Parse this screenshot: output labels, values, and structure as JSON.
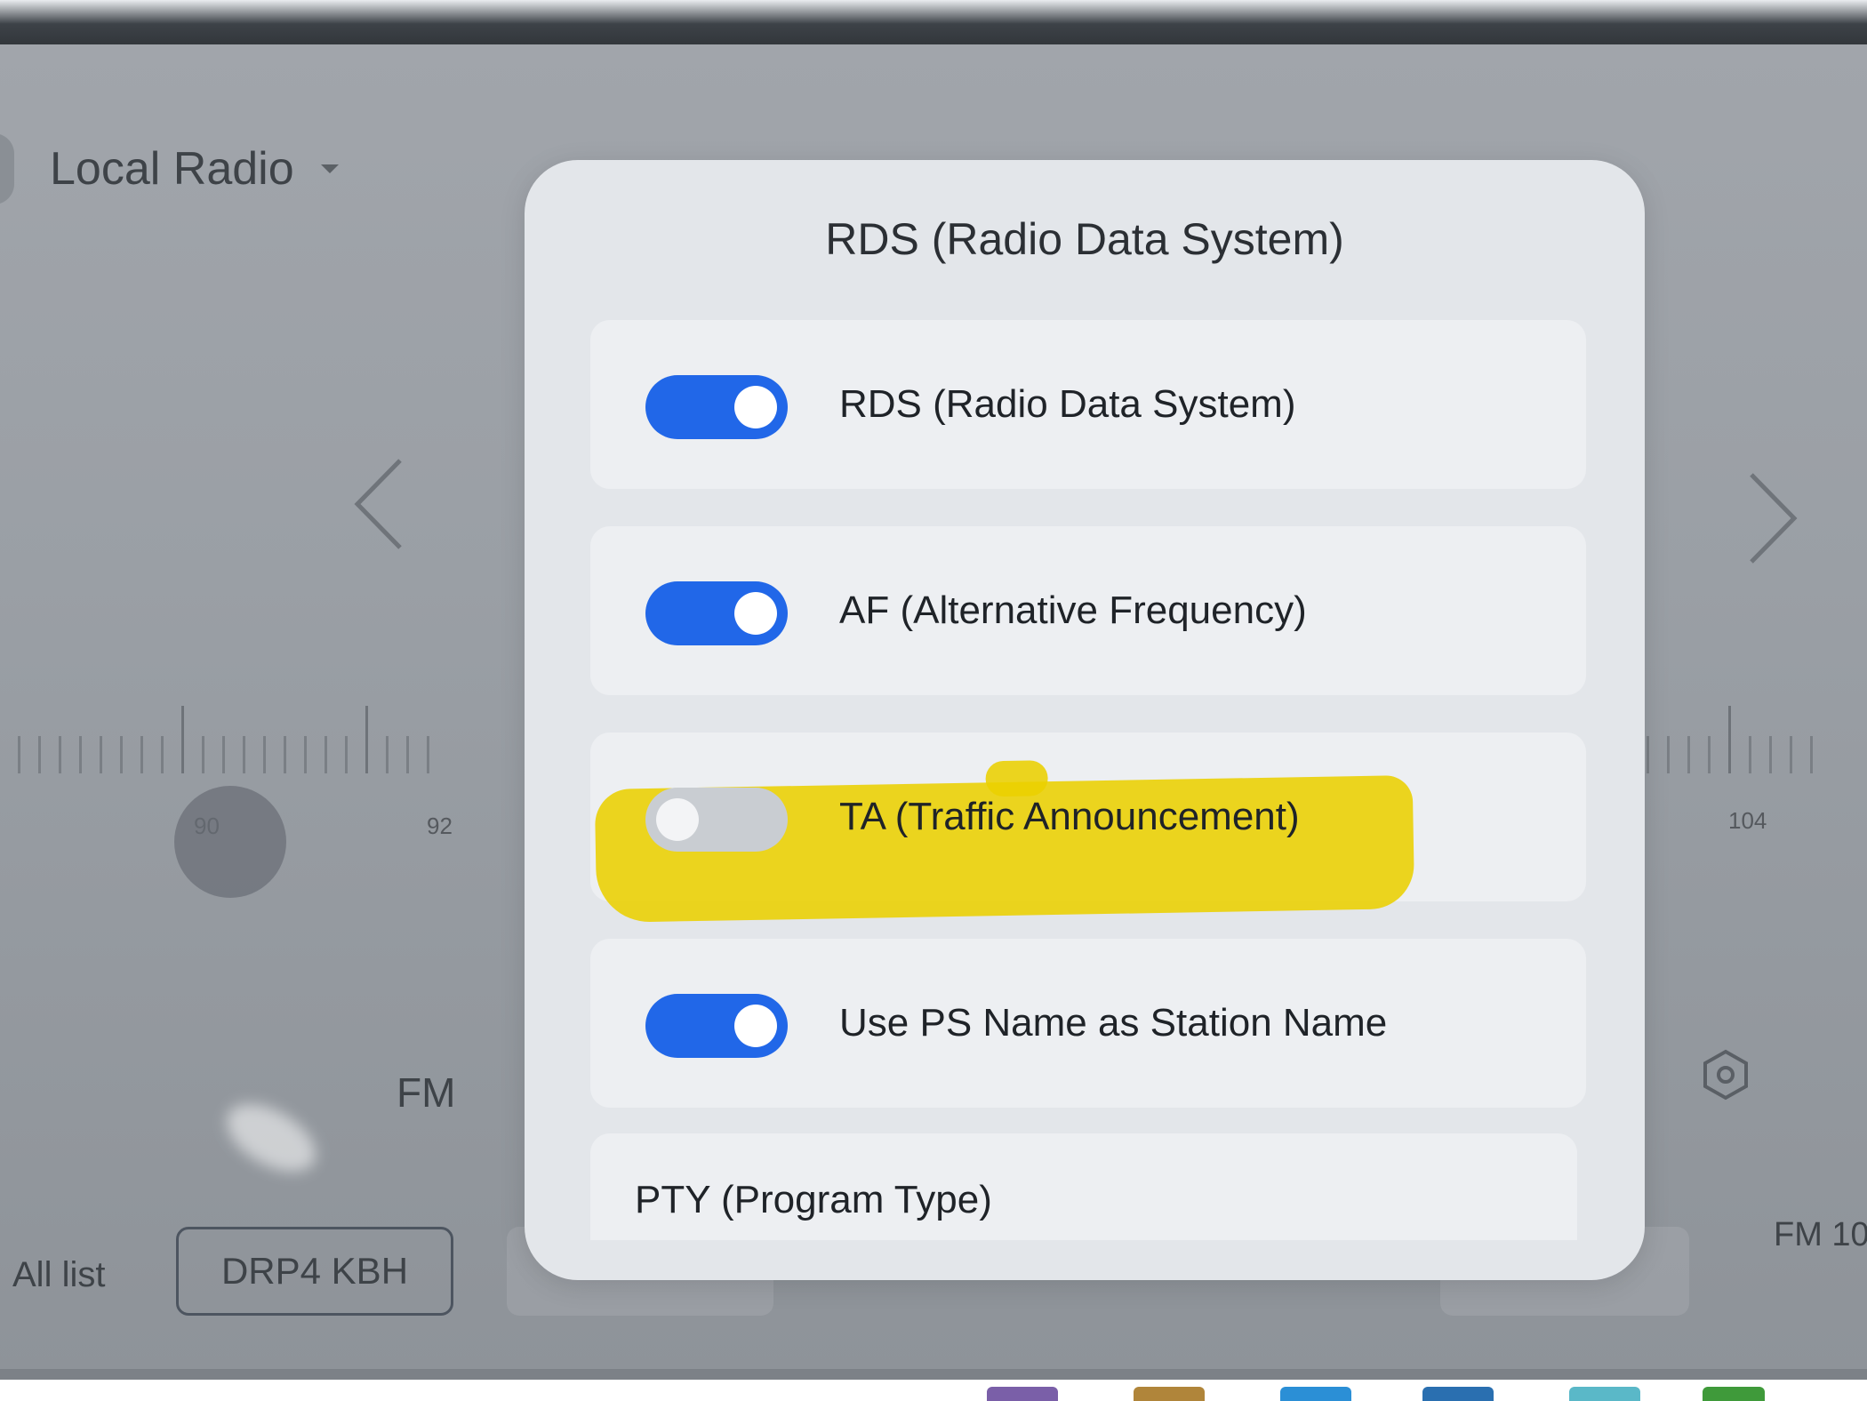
{
  "header": {
    "source_title": "Local Radio",
    "source_dropdown_icon": "chevron-down-icon"
  },
  "navigation": {
    "prev_icon": "chevron-left-icon",
    "next_icon": "chevron-right-icon"
  },
  "tuner": {
    "scale_labels": [
      "90",
      "92",
      "104"
    ],
    "band": "FM",
    "right_station_partial": "FM 10"
  },
  "bottom_bar": {
    "all_list_label": "All list",
    "current_station": "DRP4 KBH"
  },
  "settings_icon": "settings-icon",
  "dialog": {
    "title": "RDS (Radio Data System)",
    "options": [
      {
        "label": "RDS (Radio Data System)",
        "enabled": true
      },
      {
        "label": "AF (Alternative Frequency)",
        "enabled": true
      },
      {
        "label": "TA (Traffic Announcement)",
        "enabled": false
      },
      {
        "label": "Use PS Name as Station Name",
        "enabled": true
      }
    ],
    "pty_label": "PTY (Program Type)"
  },
  "colors": {
    "toggle_on": "#2167e8",
    "toggle_off": "#c9cdd2",
    "highlight": "#ebd000"
  }
}
